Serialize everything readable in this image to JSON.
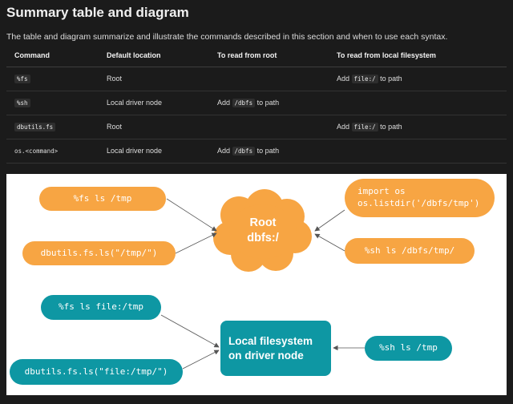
{
  "header": {
    "title": "Summary table and diagram",
    "intro": "The table and diagram summarize and illustrate the commands described in this section and when to use each syntax."
  },
  "table": {
    "columns": [
      "Command",
      "Default location",
      "To read from root",
      "To read from local filesystem"
    ],
    "rows": [
      {
        "command": "%fs",
        "location": "Root",
        "root_pre": "",
        "root_code": "",
        "root_post": "",
        "local_pre": "Add ",
        "local_code": "file:/",
        "local_post": " to path"
      },
      {
        "command": "%sh",
        "location": "Local driver node",
        "root_pre": "Add ",
        "root_code": "/dbfs",
        "root_post": " to path",
        "local_pre": "",
        "local_code": "",
        "local_post": ""
      },
      {
        "command": "dbutils.fs",
        "location": "Root",
        "root_pre": "",
        "root_code": "",
        "root_post": "",
        "local_pre": "Add ",
        "local_code": "file:/",
        "local_post": " to path"
      },
      {
        "command": "os.<command>",
        "location": "Local driver node",
        "root_pre": "Add ",
        "root_code": "/dbfs",
        "root_post": " to path",
        "local_pre": "",
        "local_code": "",
        "local_post": ""
      }
    ]
  },
  "diagram": {
    "root_cloud": {
      "line1": "Root",
      "line2": "dbfs:/"
    },
    "local_node": {
      "line1": "Local filesystem",
      "line2": "on driver node"
    },
    "orange_pills": {
      "fs_ls": "%fs ls /tmp",
      "dbutils_ls": "dbutils.fs.ls(\"/tmp/\")",
      "os_line1": "import os",
      "os_line2": "os.listdir('/dbfs/tmp')",
      "sh_ls": "%sh ls /dbfs/tmp/"
    },
    "teal_pills": {
      "fs_ls_file": "%fs ls file:/tmp",
      "dbutils_ls_file": "dbutils.fs.ls(\"file:/tmp/\")",
      "sh_ls": "%sh ls /tmp"
    },
    "colors": {
      "orange": "#f7a543",
      "teal": "#0e97a3",
      "arrow": "#555555"
    }
  }
}
